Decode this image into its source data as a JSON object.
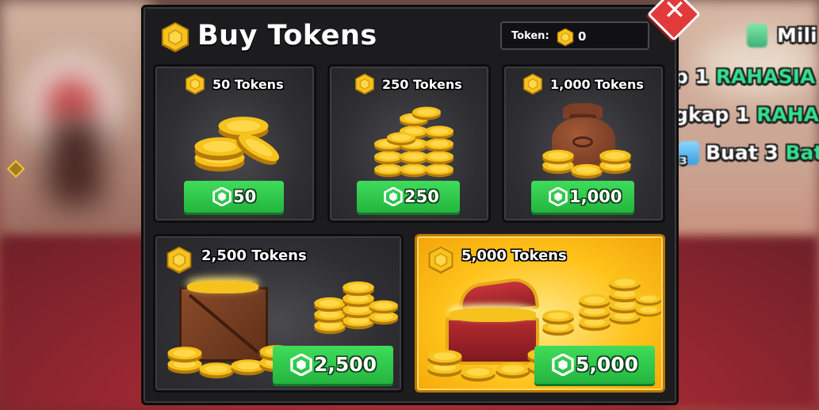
{
  "panel": {
    "title": "Buy Tokens",
    "token_label": "Token:",
    "token_value": "0"
  },
  "close_glyph": "✕",
  "products": [
    {
      "label": "50 Tokens",
      "price": "50"
    },
    {
      "label": "250 Tokens",
      "price": "250"
    },
    {
      "label": "1,000 Tokens",
      "price": "1,000"
    },
    {
      "label": "2,500 Tokens",
      "price": "2,500"
    },
    {
      "label": "5,000 Tokens",
      "price": "5,000"
    }
  ],
  "quests": [
    {
      "text": "Mili",
      "highlight": ""
    },
    {
      "text": "p 1 ",
      "highlight": "RAHASIA"
    },
    {
      "text": "gkap 1 ",
      "highlight": "RAHA"
    },
    {
      "text": "Buat 3 ",
      "highlight": "Bat",
      "badge": "3"
    }
  ],
  "colors": {
    "panel_bg": "#1c1c1f",
    "coin_gold": "#f6c21d",
    "price_green": "#2fc74b",
    "close_red": "#e23a3a",
    "quest_highlight": "#34e08e",
    "featured_gold": "#ffc21a"
  },
  "icons": {
    "coin": "hexagon-coin-icon",
    "robux": "robux-icon",
    "close": "close-icon"
  }
}
